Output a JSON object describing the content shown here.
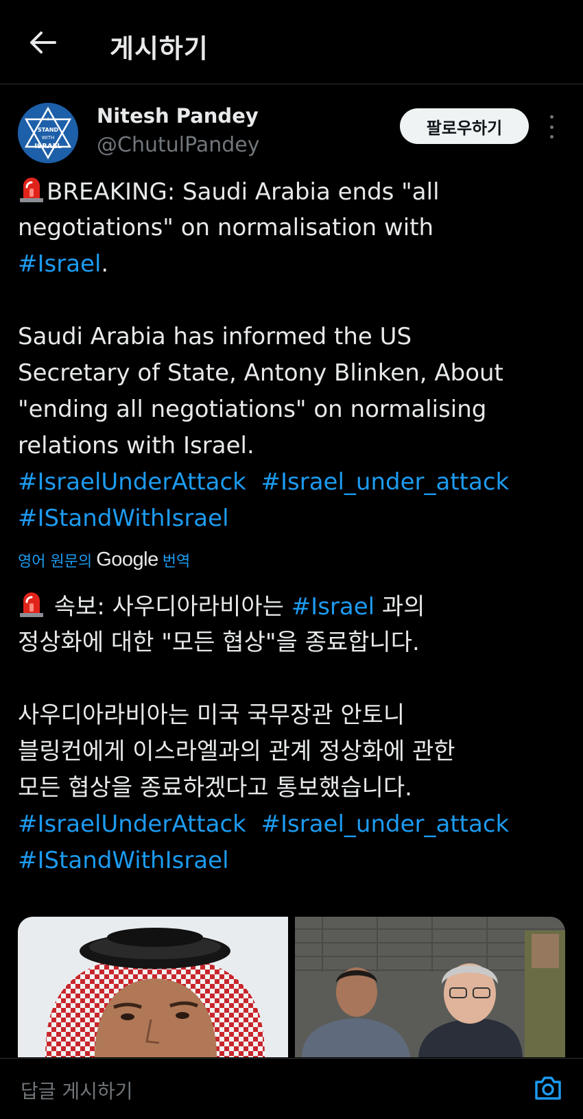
{
  "header": {
    "title": "게시하기",
    "back_icon": "arrow-left-icon"
  },
  "author": {
    "name": "Nitesh Pandey",
    "handle": "@ChutulPandey",
    "avatar_text": [
      "I",
      "STAND",
      "WITH",
      "ISRAEL"
    ]
  },
  "follow_label": "팔로우하기",
  "tweet_en": {
    "line1_text": "BREAKING: Saudi Arabia ends \"all",
    "line2": "negotiations\" on normalisation with",
    "line3_tag": "#Israel",
    "line3_suffix": ".",
    "line5": "Saudi Arabia has informed the US",
    "line6": "Secretary of State, Antony Blinken, About",
    "line7": "\"ending all negotiations\" on normalising",
    "line8": "relations with Israel.",
    "tag1": "#IsraelUnderAttack",
    "tag2": "#Israel_under_attack",
    "tag3": "#IStandWithIsrael"
  },
  "translate": {
    "prefix": "영어 원문의",
    "brand": "Google",
    "suffix": "번역"
  },
  "tweet_ko": {
    "line1_pre": "속보: 사우디아라비아는",
    "line1_tag": "#Israel",
    "line1_post": "과의",
    "line2": "정상화에 대한 \"모든 협상\"을 종료합니다.",
    "line4": "사우디아라비아는 미국 국무장관 안토니",
    "line5": "블링컨에게 이스라엘과의 관계 정상화에 관한",
    "line6": "모든 협상을 종료하겠다고 통보했습니다.",
    "tag1": "#IsraelUnderAttack",
    "tag2": "#Israel_under_attack",
    "tag3": "#IStandWithIsrael"
  },
  "reply": {
    "placeholder": "답글 게시하기",
    "camera_icon": "camera-icon"
  },
  "colors": {
    "background": "#000000",
    "text": "#e7e9ea",
    "muted": "#71767b",
    "link": "#1d9bf0",
    "divider": "#2f3336"
  }
}
